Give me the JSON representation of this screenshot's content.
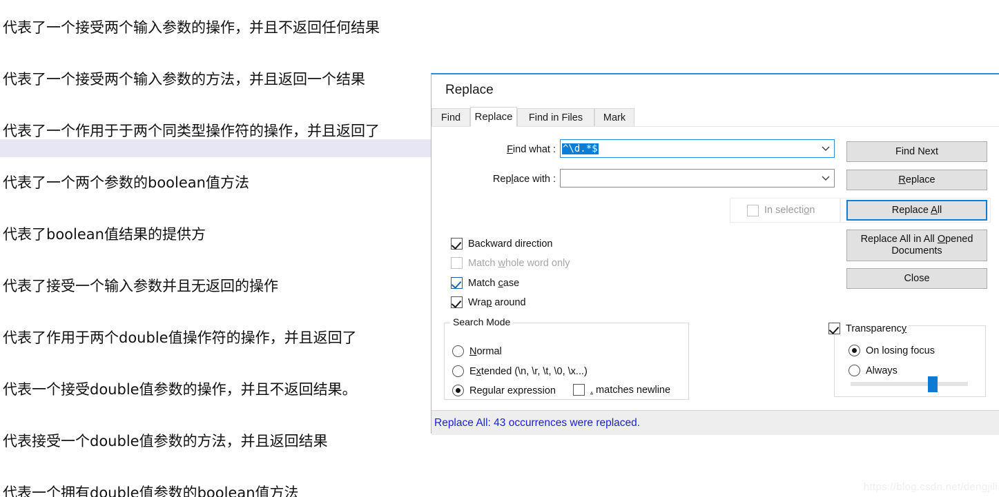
{
  "editor": {
    "lines": [
      "代表了一个接受两个输入参数的操作，并且不返回任何结果",
      "代表了一个接受两个输入参数的方法，并且返回一个结果",
      "代表了一个作用于于两个同类型操作符的操作，并且返回了",
      "",
      "代表了一个两个参数的boolean值方法",
      "代表了boolean值结果的提供方",
      "代表了接受一个输入参数并且无返回的操作",
      "代表了作用于两个double值操作符的操作，并且返回了",
      "代表一个接受double值参数的操作，并且不返回结果。",
      "代表接受一个double值参数的方法，并且返回结果",
      "代表一个拥有double值参数的boolean值方法"
    ],
    "watermark": "https://blog.csdn.net/dengjili",
    "current_line_color": "#e6e6f5"
  },
  "dialog": {
    "title": "Replace",
    "accent_color": "#2b8ad6",
    "tabs": [
      {
        "label": "Find",
        "active": false
      },
      {
        "label": "Replace",
        "active": true
      },
      {
        "label": "Find in Files",
        "active": false
      },
      {
        "label": "Mark",
        "active": false
      }
    ],
    "fields": {
      "find_label": "Find what :",
      "find_value": "^\\d.*$",
      "find_selected": true,
      "replace_label": "Replace with :",
      "replace_value": "",
      "selection_color": "#0c7cd5"
    },
    "buttons": {
      "find_next": "Find Next",
      "replace": "Replace",
      "replace_all": "Replace All",
      "replace_all_opened": "Replace All in All Opened Documents",
      "close": "Close",
      "focused": "Replace All"
    },
    "in_selection": {
      "label": "In selection",
      "checked": false,
      "disabled": true
    },
    "options": [
      {
        "label": "Backward direction",
        "checked": true,
        "disabled": false
      },
      {
        "label": "Match whole word only",
        "checked": false,
        "disabled": true
      },
      {
        "label": "Match case",
        "checked": true,
        "disabled": false
      },
      {
        "label": "Wrap around",
        "checked": true,
        "disabled": false
      }
    ],
    "search_mode": {
      "title": "Search Mode",
      "options": [
        {
          "label": "Normal",
          "selected": false
        },
        {
          "label": "Extended (\\n, \\r, \\t, \\0, \\x...)",
          "selected": false
        },
        {
          "label": "Regular expression",
          "selected": true
        }
      ],
      "dot_matches_newline": {
        "label": ". matches newline",
        "checked": false
      }
    },
    "transparency": {
      "label": "Transparency",
      "checked": true,
      "options": [
        {
          "label": "On losing focus",
          "selected": true
        },
        {
          "label": "Always",
          "selected": false
        }
      ],
      "slider_percent": 64,
      "slider_color": "#0d7bd4"
    },
    "status": {
      "message": "Replace All: 43 occurrences were replaced.",
      "color": "#1b20d8"
    }
  }
}
